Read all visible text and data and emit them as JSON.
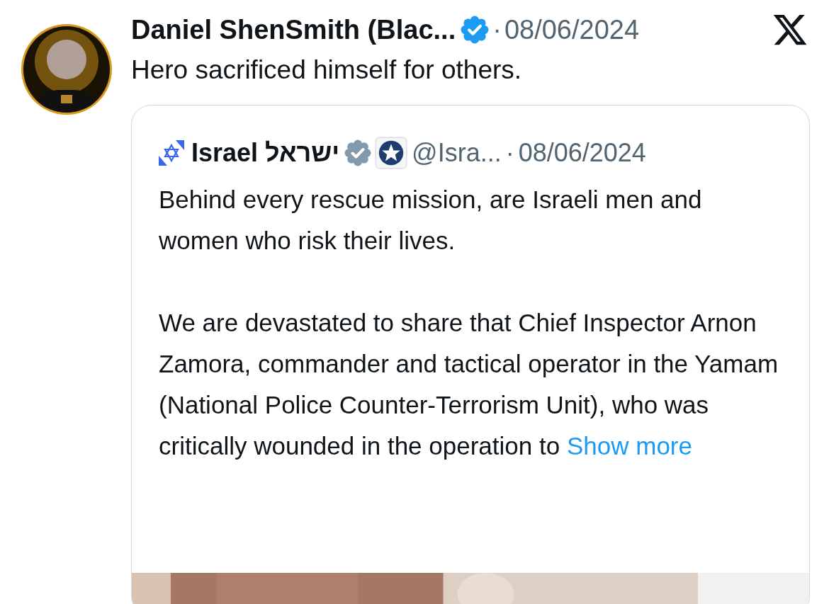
{
  "author": {
    "name": "Daniel ShenSmith (Blac...",
    "verified": true,
    "separator": "·",
    "date": "08/06/2024"
  },
  "text": "Hero sacrificed himself for others.",
  "quote": {
    "name": "Israel ישראל",
    "verified": true,
    "affiliated": true,
    "handle": "@Isra...",
    "separator": "·",
    "date": "08/06/2024",
    "paragraphs": [
      "Behind every rescue mission, are Israeli men and women who risk their lives.",
      "We are devastated to share that Chief Inspector Arnon Zamora, commander and tactical operator in the Yamam (National Police Counter-Terrorism Unit), who was critically wounded in the operation to"
    ],
    "link": "Show more"
  }
}
